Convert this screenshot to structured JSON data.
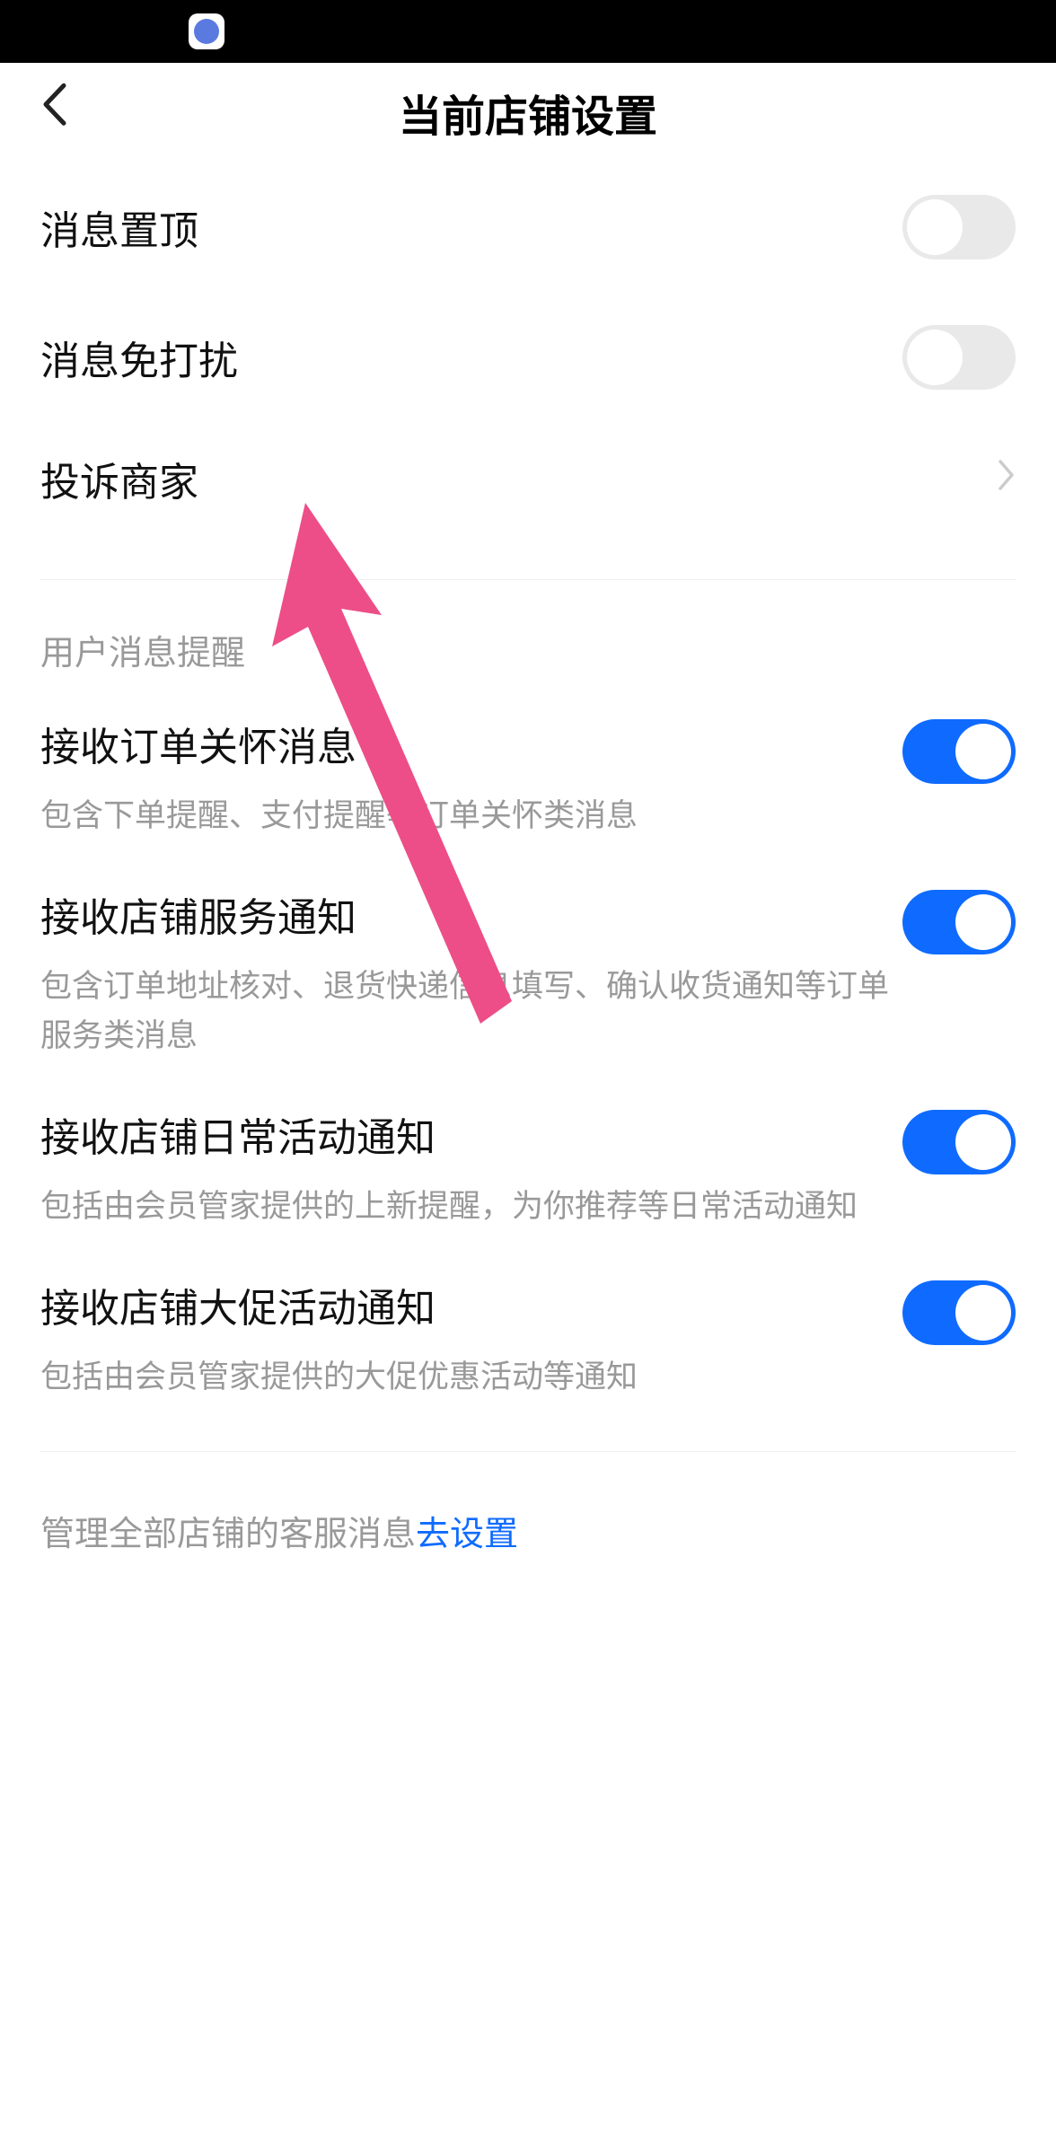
{
  "nav": {
    "title": "当前店铺设置"
  },
  "settings": {
    "pin": {
      "label": "消息置顶",
      "on": false
    },
    "dnd": {
      "label": "消息免打扰",
      "on": false
    },
    "complain": {
      "label": "投诉商家"
    }
  },
  "section_header": "用户消息提醒",
  "notifications": {
    "order_care": {
      "label": "接收订单关怀消息",
      "desc": "包含下单提醒、支付提醒等订单关怀类消息",
      "on": true
    },
    "shop_service": {
      "label": "接收店铺服务通知",
      "desc": "包含订单地址核对、退货快递信息填写、确认收货通知等订单服务类消息",
      "on": true
    },
    "daily_activity": {
      "label": "接收店铺日常活动通知",
      "desc": "包括由会员管家提供的上新提醒，为你推荐等日常活动通知",
      "on": true
    },
    "promo_activity": {
      "label": "接收店铺大促活动通知",
      "desc": "包括由会员管家提供的大促优惠活动等通知",
      "on": true
    }
  },
  "footer": {
    "text": "管理全部店铺的客服消息",
    "link": "去设置"
  },
  "colors": {
    "accent": "#0f6bff",
    "arrow": "#ec407a"
  }
}
